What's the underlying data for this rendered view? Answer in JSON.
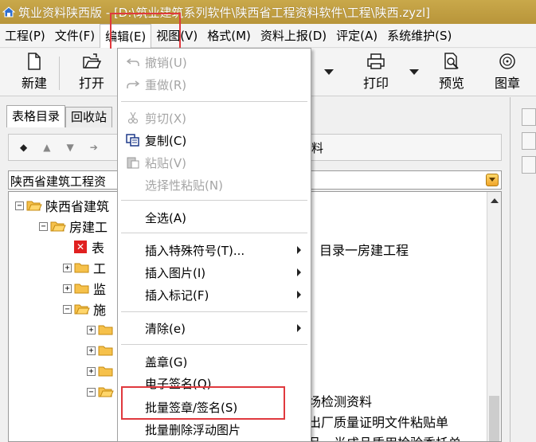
{
  "window": {
    "title": "筑业资料陕西版 - [D:\\筑业建筑系列软件\\陕西省工程资料软件\\工程\\陕西.zyzl]"
  },
  "menubar": {
    "items": [
      "工程(P)",
      "文件(F)",
      "编辑(E)",
      "视图(V)",
      "格式(M)",
      "资料上报(D)",
      "评定(A)",
      "系统维护(S)"
    ],
    "active_index": 2
  },
  "toolbar": {
    "new_label": "新建",
    "open_label": "打开",
    "print_label": "打印",
    "preview_label": "预览",
    "stamp_label": "图章"
  },
  "left_panel": {
    "tabs": [
      "表格目录",
      "回收站"
    ],
    "nav_side_label": "料",
    "combo_value": "陕西省建筑工程资",
    "tree": [
      {
        "label": "陕西省建筑",
        "level": 0,
        "expander": "−",
        "kind": "folder-open"
      },
      {
        "label": "房建工",
        "level": 1,
        "expander": "−",
        "kind": "folder-open"
      },
      {
        "label": "表",
        "level": 2,
        "expander": "",
        "kind": "red-x"
      },
      {
        "label": "工",
        "level": 2,
        "expander": "+",
        "kind": "folder"
      },
      {
        "label": "监",
        "level": 2,
        "expander": "+",
        "kind": "folder"
      },
      {
        "label": "施",
        "level": 2,
        "expander": "−",
        "kind": "folder-open"
      },
      {
        "label": "",
        "level": 3,
        "expander": "+",
        "kind": "folder"
      },
      {
        "label": "",
        "level": 3,
        "expander": "+",
        "kind": "folder"
      },
      {
        "label": "",
        "level": 3,
        "expander": "+",
        "kind": "folder"
      },
      {
        "label": "",
        "level": 3,
        "expander": "−",
        "kind": "folder-open"
      }
    ],
    "peek_texts": [
      "目录一房建工程",
      "场检测资料",
      "出厂质量证明文件粘贴单",
      "品、半成品质用检验委托单"
    ]
  },
  "edit_menu": {
    "items": [
      {
        "label": "撤销(U)",
        "disabled": true,
        "icon": "undo-icon"
      },
      {
        "label": "重做(R)",
        "disabled": true,
        "icon": "redo-icon"
      },
      {
        "label": "剪切(X)",
        "disabled": true,
        "icon": "scissors-icon"
      },
      {
        "label": "复制(C)",
        "disabled": false,
        "icon": "copy-icon"
      },
      {
        "label": "粘贴(V)",
        "disabled": true,
        "icon": "paste-icon"
      },
      {
        "label": "选择性粘贴(N)",
        "disabled": true,
        "icon": ""
      },
      {
        "label": "全选(A)",
        "disabled": false,
        "icon": ""
      },
      {
        "label": "插入特殊符号(T)...",
        "disabled": false,
        "icon": "",
        "submenu": true
      },
      {
        "label": "插入图片(I)",
        "disabled": false,
        "icon": "",
        "submenu": true
      },
      {
        "label": "插入标记(F)",
        "disabled": false,
        "icon": "",
        "submenu": true
      },
      {
        "label": "清除(e)",
        "disabled": false,
        "icon": "",
        "submenu": true
      },
      {
        "label": "盖章(G)",
        "disabled": false,
        "icon": ""
      },
      {
        "label": "电子签名(Q)",
        "disabled": false,
        "icon": ""
      },
      {
        "label": "批量签章/签名(S)",
        "disabled": false,
        "icon": "",
        "highlighted": true
      },
      {
        "label": "批量删除浮动图片",
        "disabled": false,
        "icon": ""
      }
    ]
  },
  "colors": {
    "title_bar": "#c2a144",
    "highlight_box": "#e0393e",
    "disabled_text": "#a5a5a5"
  }
}
